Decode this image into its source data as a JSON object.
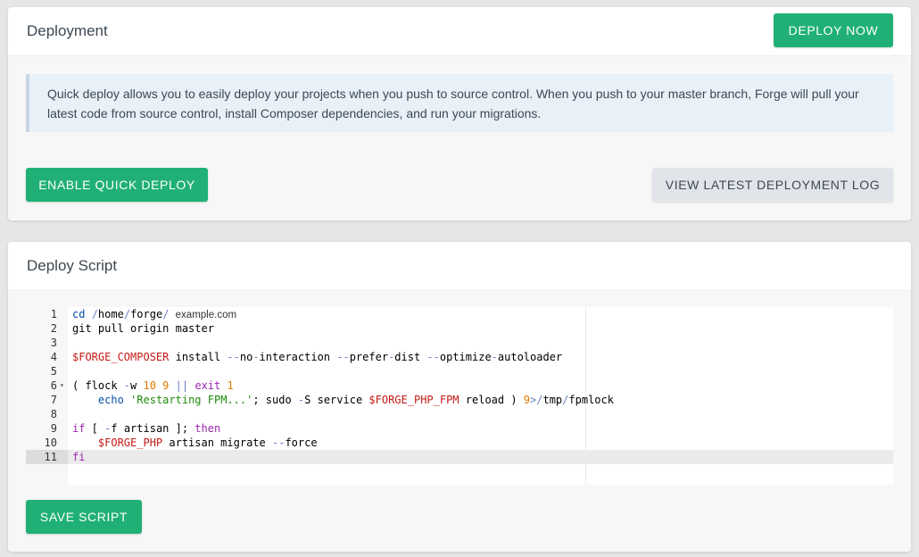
{
  "deployment": {
    "title": "Deployment",
    "deploy_now_label": "DEPLOY NOW",
    "info_text": "Quick deploy allows you to easily deploy your projects when you push to source control. When you push to your master branch, Forge will pull your latest code from source control, install Composer dependencies, and run your migrations.",
    "enable_quick_deploy_label": "ENABLE QUICK DEPLOY",
    "view_log_label": "VIEW LATEST DEPLOYMENT LOG"
  },
  "deploy_script": {
    "title": "Deploy Script",
    "save_label": "SAVE SCRIPT",
    "active_line": 11,
    "lines": [
      {
        "n": "1",
        "text": "cd /home/forge/ example.com"
      },
      {
        "n": "2",
        "text": "git pull origin master"
      },
      {
        "n": "3",
        "text": ""
      },
      {
        "n": "4",
        "text": "$FORGE_COMPOSER install --no-interaction --prefer-dist --optimize-autoloader"
      },
      {
        "n": "5",
        "text": ""
      },
      {
        "n": "6",
        "text": "( flock -w 10 9 || exit 1"
      },
      {
        "n": "7",
        "text": "    echo 'Restarting FPM...'; sudo -S service $FORGE_PHP_FPM reload ) 9>/tmp/fpmlock"
      },
      {
        "n": "8",
        "text": ""
      },
      {
        "n": "9",
        "text": "if [ -f artisan ]; then"
      },
      {
        "n": "10",
        "text": "    $FORGE_PHP artisan migrate --force"
      },
      {
        "n": "11",
        "text": "fi"
      }
    ]
  },
  "colors": {
    "accent_green": "#20b075",
    "info_bg": "#e8f0f8",
    "gray_button": "#e1e5ea"
  }
}
